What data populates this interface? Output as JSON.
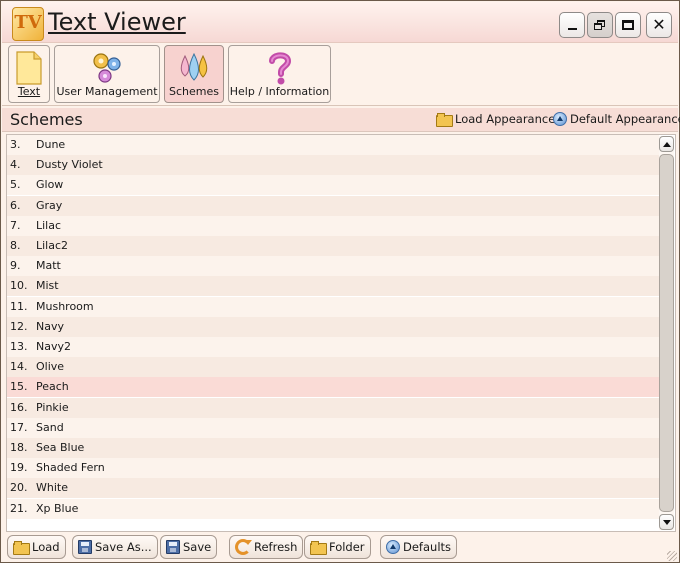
{
  "app": {
    "title": "Text Viewer",
    "logo_text": "TV",
    "window_controls": [
      "minimize",
      "restore",
      "maximize",
      "close"
    ]
  },
  "toolbar": {
    "items": [
      {
        "label": "Text",
        "icon": "document-icon"
      },
      {
        "label": "User Management",
        "icon": "gears-icon"
      },
      {
        "label": "Schemes",
        "icon": "color-drops-icon",
        "active": true
      },
      {
        "label": "Help / Information",
        "icon": "question-mark-icon"
      }
    ]
  },
  "section": {
    "title": "Schemes",
    "load_appearance": "Load Appearance",
    "default_appearance": "Default Appearance"
  },
  "schemes": [
    {
      "num": "3.",
      "name": "Dune"
    },
    {
      "num": "4.",
      "name": "Dusty Violet"
    },
    {
      "num": "5.",
      "name": "Glow"
    },
    {
      "num": "6.",
      "name": "Gray"
    },
    {
      "num": "7.",
      "name": "Lilac"
    },
    {
      "num": "8.",
      "name": "Lilac2"
    },
    {
      "num": "9.",
      "name": "Matt"
    },
    {
      "num": "10.",
      "name": "Mist"
    },
    {
      "num": "11.",
      "name": "Mushroom"
    },
    {
      "num": "12.",
      "name": "Navy"
    },
    {
      "num": "13.",
      "name": "Navy2"
    },
    {
      "num": "14.",
      "name": "Olive"
    },
    {
      "num": "15.",
      "name": "Peach",
      "selected": true
    },
    {
      "num": "16.",
      "name": "Pinkie"
    },
    {
      "num": "17.",
      "name": "Sand"
    },
    {
      "num": "18.",
      "name": "Sea Blue"
    },
    {
      "num": "19.",
      "name": "Shaded Fern"
    },
    {
      "num": "20.",
      "name": "White"
    },
    {
      "num": "21.",
      "name": "Xp Blue"
    }
  ],
  "bottom_toolbar": {
    "load": "Load",
    "save_as": "Save As...",
    "save": "Save",
    "refresh": "Refresh",
    "folder": "Folder",
    "defaults": "Defaults"
  },
  "colors": {
    "background": "#fdf2ea",
    "header": "#f7ddd6",
    "selected_row": "#fadbd6"
  }
}
